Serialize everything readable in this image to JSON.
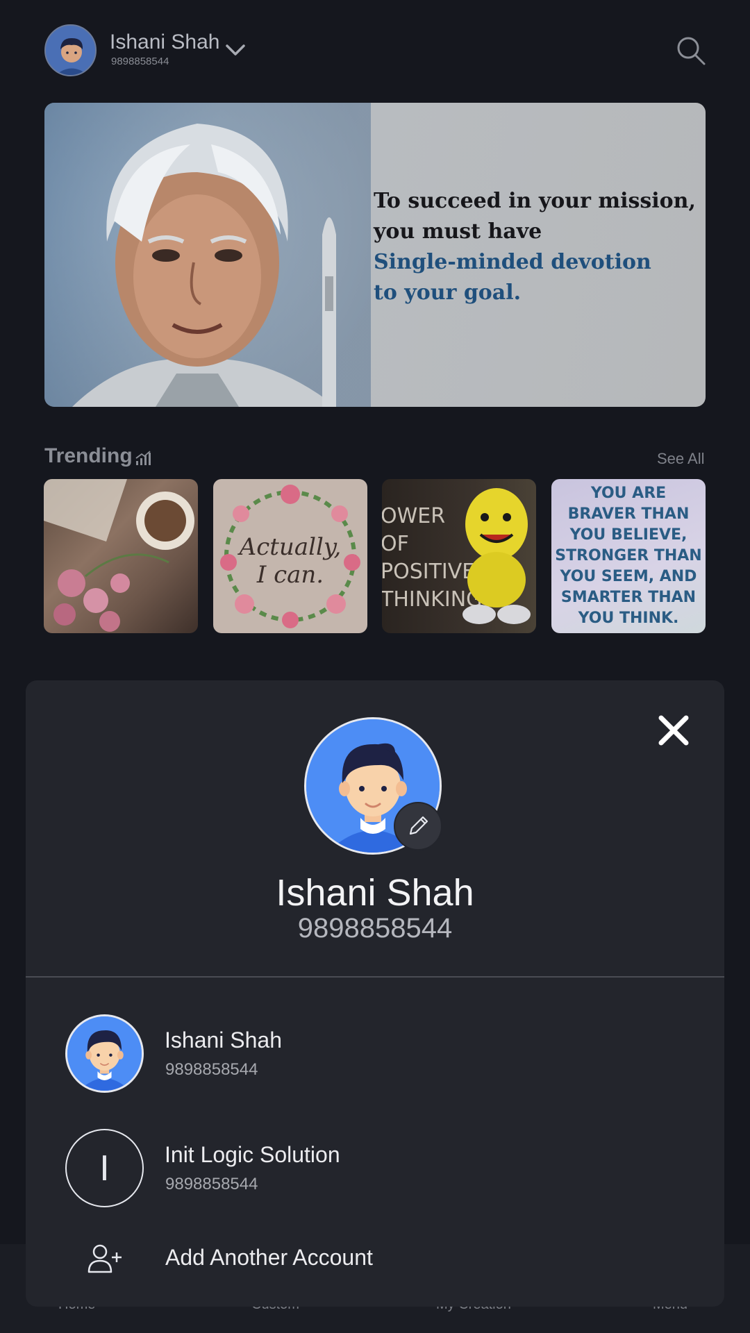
{
  "header": {
    "name": "Ishani Shah",
    "phone": "9898858544"
  },
  "banner": {
    "line1": "To succeed in your mission,",
    "line2": "you must have",
    "line3": "Single-minded devotion",
    "line4": "to your goal."
  },
  "trending": {
    "title": "Trending",
    "see_all": "See All",
    "thumb2_text": [
      "Actually,",
      "I can."
    ],
    "thumb3_text": [
      "OWER OF",
      "POSITIVE",
      "THINKING"
    ],
    "thumb4_text": [
      "YOU ARE",
      "BRAVER THAN",
      "YOU BELIEVE,",
      "STRONGER THAN",
      "YOU SEEM, AND",
      "SMARTER THAN",
      "YOU THINK."
    ]
  },
  "bottom_nav": [
    "Home",
    "Custom",
    "My Creation",
    "Menu"
  ],
  "sheet": {
    "name": "Ishani Shah",
    "phone": "9898858544",
    "accounts": [
      {
        "name": "Ishani Shah",
        "phone": "9898858544"
      },
      {
        "name": "Init Logic Solution",
        "phone": "9898858544",
        "initial": "I"
      }
    ],
    "add_account": "Add Another Account"
  },
  "colors": {
    "background": "#15171e",
    "sheet": "#23252c",
    "avatar_blue": "#4d8df5",
    "banner_blue_text": "#1f4f7c"
  }
}
